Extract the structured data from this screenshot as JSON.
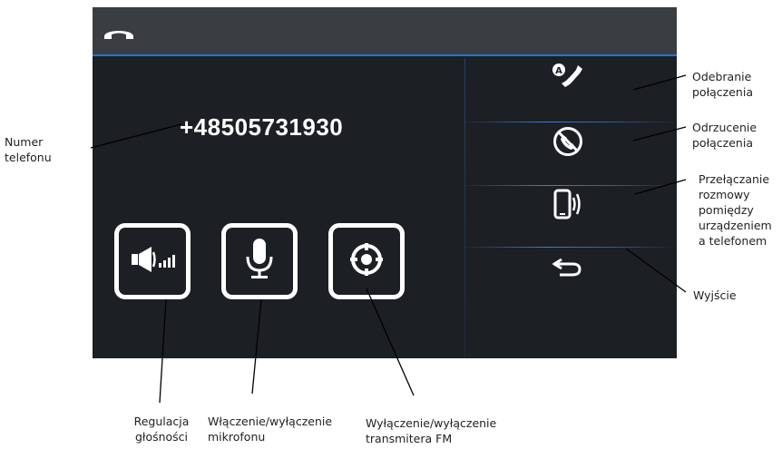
{
  "screen": {
    "phone_number": "+48505731930",
    "topbar_icon": "hangup-icon",
    "side_buttons": [
      {
        "name": "answer-call-button",
        "icon": "phone-answer-a-icon"
      },
      {
        "name": "reject-call-button",
        "icon": "phone-reject-icon"
      },
      {
        "name": "switch-device-button",
        "icon": "smartphone-transfer-icon"
      },
      {
        "name": "exit-button",
        "icon": "back-arrow-icon"
      }
    ],
    "main_buttons": [
      {
        "name": "volume-button",
        "icon": "speaker-volume-icon"
      },
      {
        "name": "microphone-button",
        "icon": "microphone-icon"
      },
      {
        "name": "fm-transmitter-button",
        "icon": "target-icon"
      }
    ],
    "colors": {
      "screen_bg": "#1c1f24",
      "topbar_bg": "#3a3d42",
      "accent_blue": "#1f77d6",
      "icon": "#ffffff"
    }
  },
  "annotations": {
    "phone_number": "Numer\ntelefonu",
    "answer": "Odebranie\npołączenia",
    "reject": "Odrzucenie\npołączenia",
    "switch": "Przełączanie\nrozmowy\npomiędzy\nurządzeniem\na telefonem",
    "exit": "Wyjście",
    "volume": "Regulacja\ngłośności",
    "microphone": "Włączenie/wyłączenie\nmikrofonu",
    "fm": "Wyłączenie/wyłączenie\ntransmitera FM"
  }
}
